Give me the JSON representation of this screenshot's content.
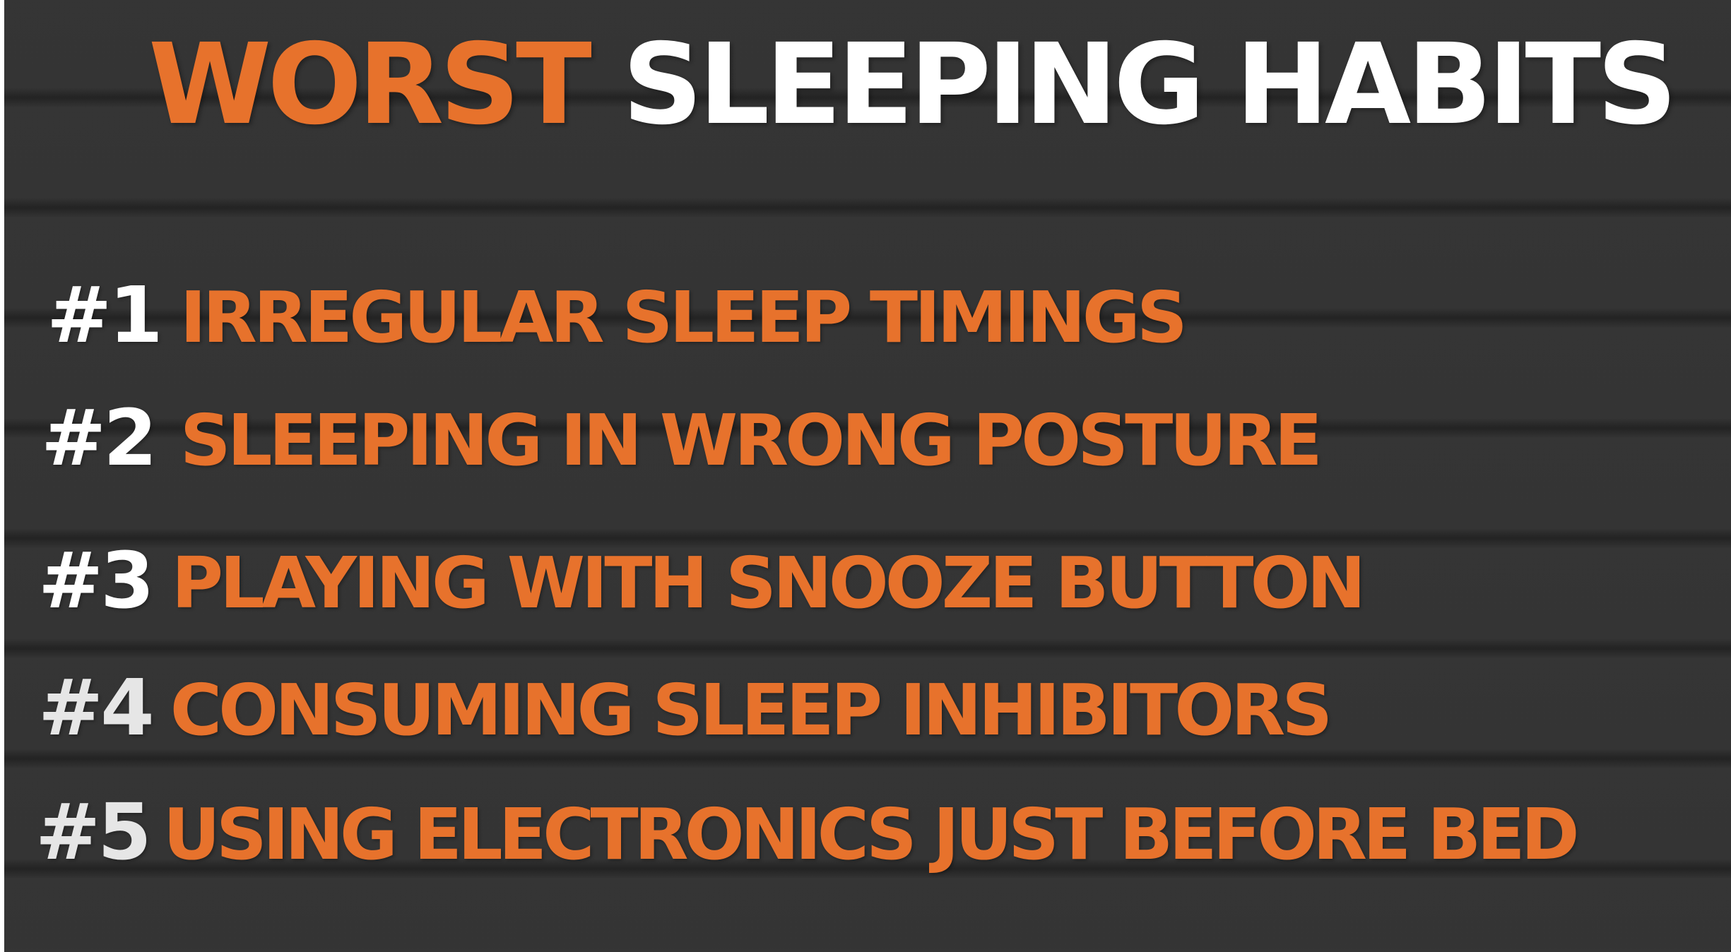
{
  "slide": {
    "title": {
      "accent": "WORST",
      "rest": "SLEEPING HABITS"
    },
    "habits": [
      {
        "number": "#1",
        "text": "IRREGULAR SLEEP TIMINGS"
      },
      {
        "number": "#2",
        "text": "SLEEPING IN WRONG POSTURE"
      },
      {
        "number": "#3",
        "text": "PLAYING WITH SNOOZE BUTTON"
      },
      {
        "number": "#4",
        "text": "CONSUMING SLEEP INHIBITORS"
      },
      {
        "number": "#5",
        "text": "USING ELECTRONICS JUST BEFORE BED"
      }
    ]
  },
  "colors": {
    "accent": "#e7722c",
    "white": "#ffffff",
    "background": "#343434",
    "stripe": "#232323"
  }
}
